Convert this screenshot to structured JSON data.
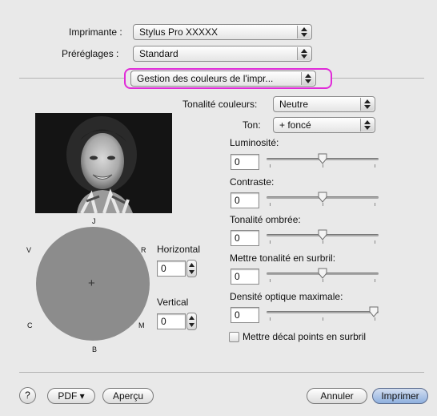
{
  "top": {
    "printer_label": "Imprimante :",
    "printer_value": "Stylus Pro XXXXX",
    "presets_label": "Préréglages :",
    "presets_value": "Standard",
    "panel_value": "Gestion des couleurs de l'impr..."
  },
  "color": {
    "tone_label": "Tonalité couleurs:",
    "tone_value": "Neutre",
    "ton_label": "Ton:",
    "ton_value": "+ foncé"
  },
  "sliders": [
    {
      "label": "Luminosité:",
      "value": "0",
      "level": 0.5
    },
    {
      "label": "Contraste:",
      "value": "0",
      "level": 0.5
    },
    {
      "label": "Tonalité ombrée:",
      "value": "0",
      "level": 0.5
    },
    {
      "label": "Mettre tonalité en surbril:",
      "value": "0",
      "level": 0.5
    },
    {
      "label": "Densité optique maximale:",
      "value": "0",
      "level": 1.0
    }
  ],
  "checkbox": {
    "label": "Mettre décal points en surbril",
    "checked": false
  },
  "wheel": {
    "top": "J",
    "left": "V",
    "right_top": "R",
    "left_bottom": "C",
    "right_bottom": "M",
    "bottom": "B",
    "center": "+",
    "fill": "#8c8c8c"
  },
  "offset": {
    "horizontal_label": "Horizontal",
    "horizontal_value": "0",
    "vertical_label": "Vertical",
    "vertical_value": "0"
  },
  "footer": {
    "help": "?",
    "pdf": "PDF ▾",
    "preview": "Aperçu",
    "cancel": "Annuler",
    "print": "Imprimer"
  },
  "colors": {
    "highlight": "#e02ad8",
    "default_button": "#8fb0df"
  }
}
